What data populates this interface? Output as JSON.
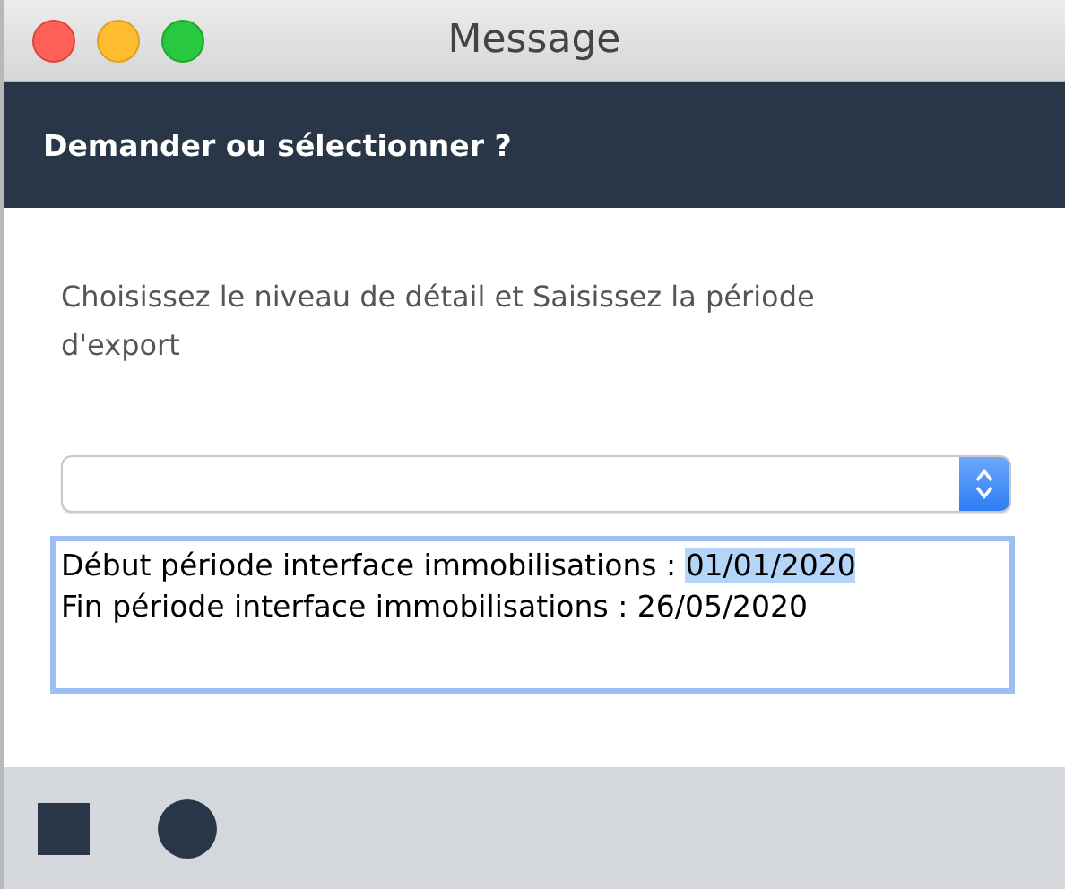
{
  "window": {
    "title": "Message"
  },
  "header": {
    "title": "Demander ou sélectionner ?"
  },
  "description": "Choisissez le niveau de détail et Saisissez la période d'export",
  "text_area": {
    "lines": [
      {
        "label": "Début période interface immobilisations : ",
        "value": "01/01/2020",
        "selected": true
      },
      {
        "label": "Fin période interface immobilisations : ",
        "value": "26/05/2020",
        "selected": false
      }
    ]
  },
  "footer": {
    "buttons": [
      {
        "kind": "stop"
      },
      {
        "kind": "record"
      }
    ]
  }
}
